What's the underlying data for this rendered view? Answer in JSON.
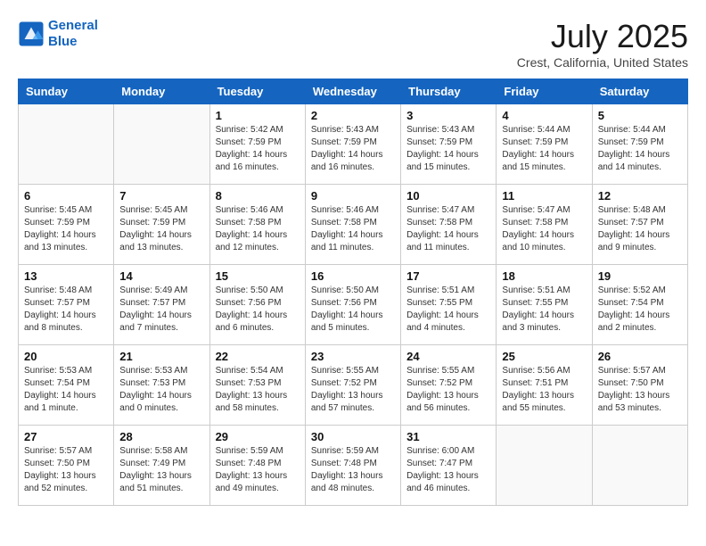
{
  "header": {
    "logo_line1": "General",
    "logo_line2": "Blue",
    "month": "July 2025",
    "location": "Crest, California, United States"
  },
  "weekdays": [
    "Sunday",
    "Monday",
    "Tuesday",
    "Wednesday",
    "Thursday",
    "Friday",
    "Saturday"
  ],
  "weeks": [
    [
      {
        "day": "",
        "info": ""
      },
      {
        "day": "",
        "info": ""
      },
      {
        "day": "1",
        "info": "Sunrise: 5:42 AM\nSunset: 7:59 PM\nDaylight: 14 hours and 16 minutes."
      },
      {
        "day": "2",
        "info": "Sunrise: 5:43 AM\nSunset: 7:59 PM\nDaylight: 14 hours and 16 minutes."
      },
      {
        "day": "3",
        "info": "Sunrise: 5:43 AM\nSunset: 7:59 PM\nDaylight: 14 hours and 15 minutes."
      },
      {
        "day": "4",
        "info": "Sunrise: 5:44 AM\nSunset: 7:59 PM\nDaylight: 14 hours and 15 minutes."
      },
      {
        "day": "5",
        "info": "Sunrise: 5:44 AM\nSunset: 7:59 PM\nDaylight: 14 hours and 14 minutes."
      }
    ],
    [
      {
        "day": "6",
        "info": "Sunrise: 5:45 AM\nSunset: 7:59 PM\nDaylight: 14 hours and 13 minutes."
      },
      {
        "day": "7",
        "info": "Sunrise: 5:45 AM\nSunset: 7:59 PM\nDaylight: 14 hours and 13 minutes."
      },
      {
        "day": "8",
        "info": "Sunrise: 5:46 AM\nSunset: 7:58 PM\nDaylight: 14 hours and 12 minutes."
      },
      {
        "day": "9",
        "info": "Sunrise: 5:46 AM\nSunset: 7:58 PM\nDaylight: 14 hours and 11 minutes."
      },
      {
        "day": "10",
        "info": "Sunrise: 5:47 AM\nSunset: 7:58 PM\nDaylight: 14 hours and 11 minutes."
      },
      {
        "day": "11",
        "info": "Sunrise: 5:47 AM\nSunset: 7:58 PM\nDaylight: 14 hours and 10 minutes."
      },
      {
        "day": "12",
        "info": "Sunrise: 5:48 AM\nSunset: 7:57 PM\nDaylight: 14 hours and 9 minutes."
      }
    ],
    [
      {
        "day": "13",
        "info": "Sunrise: 5:48 AM\nSunset: 7:57 PM\nDaylight: 14 hours and 8 minutes."
      },
      {
        "day": "14",
        "info": "Sunrise: 5:49 AM\nSunset: 7:57 PM\nDaylight: 14 hours and 7 minutes."
      },
      {
        "day": "15",
        "info": "Sunrise: 5:50 AM\nSunset: 7:56 PM\nDaylight: 14 hours and 6 minutes."
      },
      {
        "day": "16",
        "info": "Sunrise: 5:50 AM\nSunset: 7:56 PM\nDaylight: 14 hours and 5 minutes."
      },
      {
        "day": "17",
        "info": "Sunrise: 5:51 AM\nSunset: 7:55 PM\nDaylight: 14 hours and 4 minutes."
      },
      {
        "day": "18",
        "info": "Sunrise: 5:51 AM\nSunset: 7:55 PM\nDaylight: 14 hours and 3 minutes."
      },
      {
        "day": "19",
        "info": "Sunrise: 5:52 AM\nSunset: 7:54 PM\nDaylight: 14 hours and 2 minutes."
      }
    ],
    [
      {
        "day": "20",
        "info": "Sunrise: 5:53 AM\nSunset: 7:54 PM\nDaylight: 14 hours and 1 minute."
      },
      {
        "day": "21",
        "info": "Sunrise: 5:53 AM\nSunset: 7:53 PM\nDaylight: 14 hours and 0 minutes."
      },
      {
        "day": "22",
        "info": "Sunrise: 5:54 AM\nSunset: 7:53 PM\nDaylight: 13 hours and 58 minutes."
      },
      {
        "day": "23",
        "info": "Sunrise: 5:55 AM\nSunset: 7:52 PM\nDaylight: 13 hours and 57 minutes."
      },
      {
        "day": "24",
        "info": "Sunrise: 5:55 AM\nSunset: 7:52 PM\nDaylight: 13 hours and 56 minutes."
      },
      {
        "day": "25",
        "info": "Sunrise: 5:56 AM\nSunset: 7:51 PM\nDaylight: 13 hours and 55 minutes."
      },
      {
        "day": "26",
        "info": "Sunrise: 5:57 AM\nSunset: 7:50 PM\nDaylight: 13 hours and 53 minutes."
      }
    ],
    [
      {
        "day": "27",
        "info": "Sunrise: 5:57 AM\nSunset: 7:50 PM\nDaylight: 13 hours and 52 minutes."
      },
      {
        "day": "28",
        "info": "Sunrise: 5:58 AM\nSunset: 7:49 PM\nDaylight: 13 hours and 51 minutes."
      },
      {
        "day": "29",
        "info": "Sunrise: 5:59 AM\nSunset: 7:48 PM\nDaylight: 13 hours and 49 minutes."
      },
      {
        "day": "30",
        "info": "Sunrise: 5:59 AM\nSunset: 7:48 PM\nDaylight: 13 hours and 48 minutes."
      },
      {
        "day": "31",
        "info": "Sunrise: 6:00 AM\nSunset: 7:47 PM\nDaylight: 13 hours and 46 minutes."
      },
      {
        "day": "",
        "info": ""
      },
      {
        "day": "",
        "info": ""
      }
    ]
  ]
}
